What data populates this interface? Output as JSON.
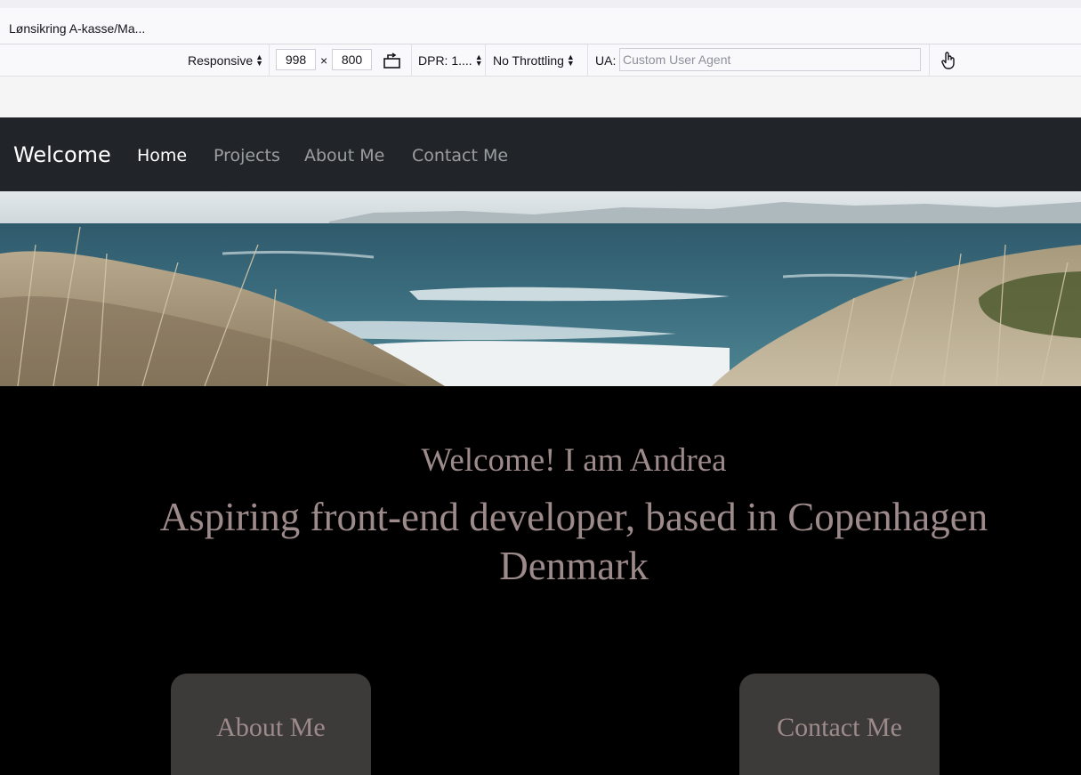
{
  "browser": {
    "tab_title": "Lønsikring A-kasse/Ma..."
  },
  "rdm_toolbar": {
    "device": "Responsive",
    "width": "998",
    "times": "×",
    "height": "800",
    "dpr": "DPR: 1....",
    "throttling": "No Throttling",
    "ua_label": "UA:",
    "ua_placeholder": "Custom User Agent"
  },
  "site": {
    "brand": "Welcome",
    "nav": [
      {
        "label": "Home",
        "active": true
      },
      {
        "label": "Projects",
        "active": false
      },
      {
        "label": "About Me",
        "active": false
      },
      {
        "label": "Contact Me",
        "active": false
      }
    ],
    "hello": "Welcome! I am Andrea",
    "tagline": "Aspiring front-end developer, based in Copenhagen Denmark",
    "buttons": {
      "about": "About Me",
      "contact": "Contact Me"
    },
    "colors": {
      "navbar": "#212529",
      "text": "#9d8a8a",
      "button_bg": "#3d3b3a"
    }
  }
}
